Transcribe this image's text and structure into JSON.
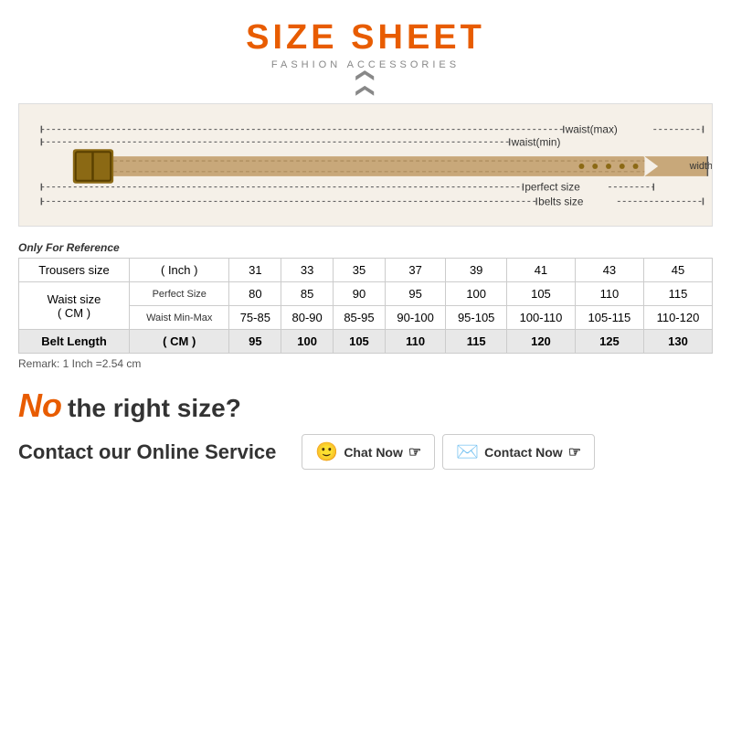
{
  "title": "SIZE SHEET",
  "subtitle": "FASHION ACCESSORIES",
  "only_ref": "Only For Reference",
  "table": {
    "col_headers": [
      "31",
      "33",
      "35",
      "37",
      "39",
      "41",
      "43",
      "45"
    ],
    "row1_label": "Trousers size",
    "row1_unit": "( Inch )",
    "row2_label": "Waist size",
    "row2_unit": "( CM )",
    "row2_sub1": "Perfect Size",
    "row2_sub2": "Waist Min-Max",
    "row3_label": "Belt Length",
    "row3_unit": "( CM )",
    "perfect_size": [
      "80",
      "85",
      "90",
      "95",
      "100",
      "105",
      "110",
      "115"
    ],
    "waist_min_max": [
      "75-85",
      "80-90",
      "85-95",
      "90-100",
      "95-105",
      "100-110",
      "105-115",
      "110-120"
    ],
    "belt_length": [
      "95",
      "100",
      "105",
      "110",
      "115",
      "120",
      "125",
      "130"
    ]
  },
  "remark": "Remark: 1 Inch =2.54 cm",
  "no_size_line1_no": "No",
  "no_size_line1_rest": "the right size?",
  "contact_text": "Contact our Online Service",
  "chat_now": "Chat Now",
  "contact_now": "Contact Now"
}
